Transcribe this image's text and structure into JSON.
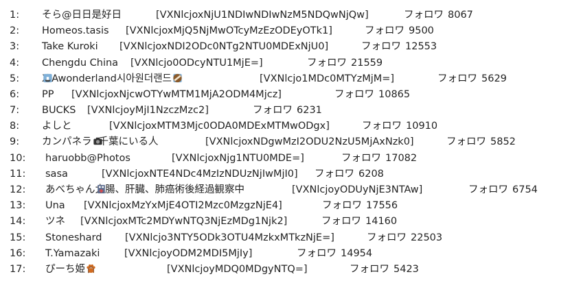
{
  "follow_label": "フォロワ",
  "rows": [
    {
      "num": "1:",
      "name": "そら@日日是好日",
      "id": "[VXNlcjoxNjU1NDIwNDIwNzM5NDQwNjQw]",
      "count": "8067"
    },
    {
      "num": "2:",
      "name": "Homeos.tasis",
      "id": "[VXNlcjoxMjQ5NjMwOTcyMzEzODEyOTk1]",
      "count": "9500"
    },
    {
      "num": "3:",
      "name": "Take Kuroki",
      "id": "[VXNlcjoxNDI2ODc0NTg2NTU0MDExNjU0]",
      "count": "12553"
    },
    {
      "num": "4:",
      "name": "Chengdu China",
      "id": "[VXNlcjo0ODcyNTU1MjE=]",
      "count": "21559"
    },
    {
      "num": "5:",
      "name_pre_icons": [
        "coconut-icon",
        "boat-icon"
      ],
      "name": "XIAwonderland시아원더랜드",
      "name_post_icons": [
        "boat-icon",
        "coconut-icon"
      ],
      "id": "[VXNlcjo1MDc0MTYzMjM=]",
      "count": "5629"
    },
    {
      "num": "6:",
      "name": "PP",
      "id": "[VXNlcjoxNjcwOTYwMTM1MjA2ODM4Mjcz]",
      "count": "10865"
    },
    {
      "num": "7:",
      "name": "BUCKS",
      "id": "[VXNlcjoyMjI1NzczMzc2]",
      "count": "6231"
    },
    {
      "num": "8:",
      "name": "よしと",
      "id": "[VXNlcjoxMTM3Mjc0ODA0MDExMTMwODgx]",
      "count": "10910"
    },
    {
      "num": "9:",
      "name": "カンパネラ",
      "name_mid_icons": [
        "camera-icon"
      ],
      "name_after": "千葉にいる人",
      "id": "[VXNlcjoxNDgwMzI2ODU2NzU5MjAxNzk0]",
      "count": "5852"
    },
    {
      "num": "10:",
      "name": "haruobb@Photos",
      "id": "[VXNlcjoxNjg1NTU0MDE=]",
      "count": "17082"
    },
    {
      "num": "11:",
      "name": "sasa",
      "id": "[VXNlcjoxNTE4NDc4MzIzNDUzNjIwMjI0]",
      "count": "6208"
    },
    {
      "num": "12:",
      "name": "あべちゃん",
      "name_mid_icons": [
        "hospital-icon"
      ],
      "name_after": "大腸、肝臓、肺癌術後経過観察中",
      "id": "[VXNlcjoyODUyNjE3NTAw]",
      "count": "6754"
    },
    {
      "num": "13:",
      "name": "Una",
      "id": "[VXNlcjoxMzYxMjE4OTI2Mzc0MzgzNjE4]",
      "count": "17556"
    },
    {
      "num": "14:",
      "name": "ツネ",
      "id": "[VXNlcjoxMTc2MDYwNTQ3NjEzMDg1Njk2]",
      "count": "14160"
    },
    {
      "num": "15:",
      "name": "Stoneshard",
      "id": "[VXNlcjo3NTY5ODk3OTU4MzkxMTkzNjE=]",
      "count": "22503"
    },
    {
      "num": "16:",
      "name": "T.Yamazaki",
      "id": "[VXNlcjoyODM2MDI5MjIy]",
      "count": "14954"
    },
    {
      "num": "17:",
      "name": "ぴーち姫",
      "name_post_icons": [
        "princess-icon",
        "ghost-icon",
        "paw-icon"
      ],
      "id": "[VXNlcjoyMDQ0MDgyNTQ=]",
      "count": "5423"
    }
  ]
}
